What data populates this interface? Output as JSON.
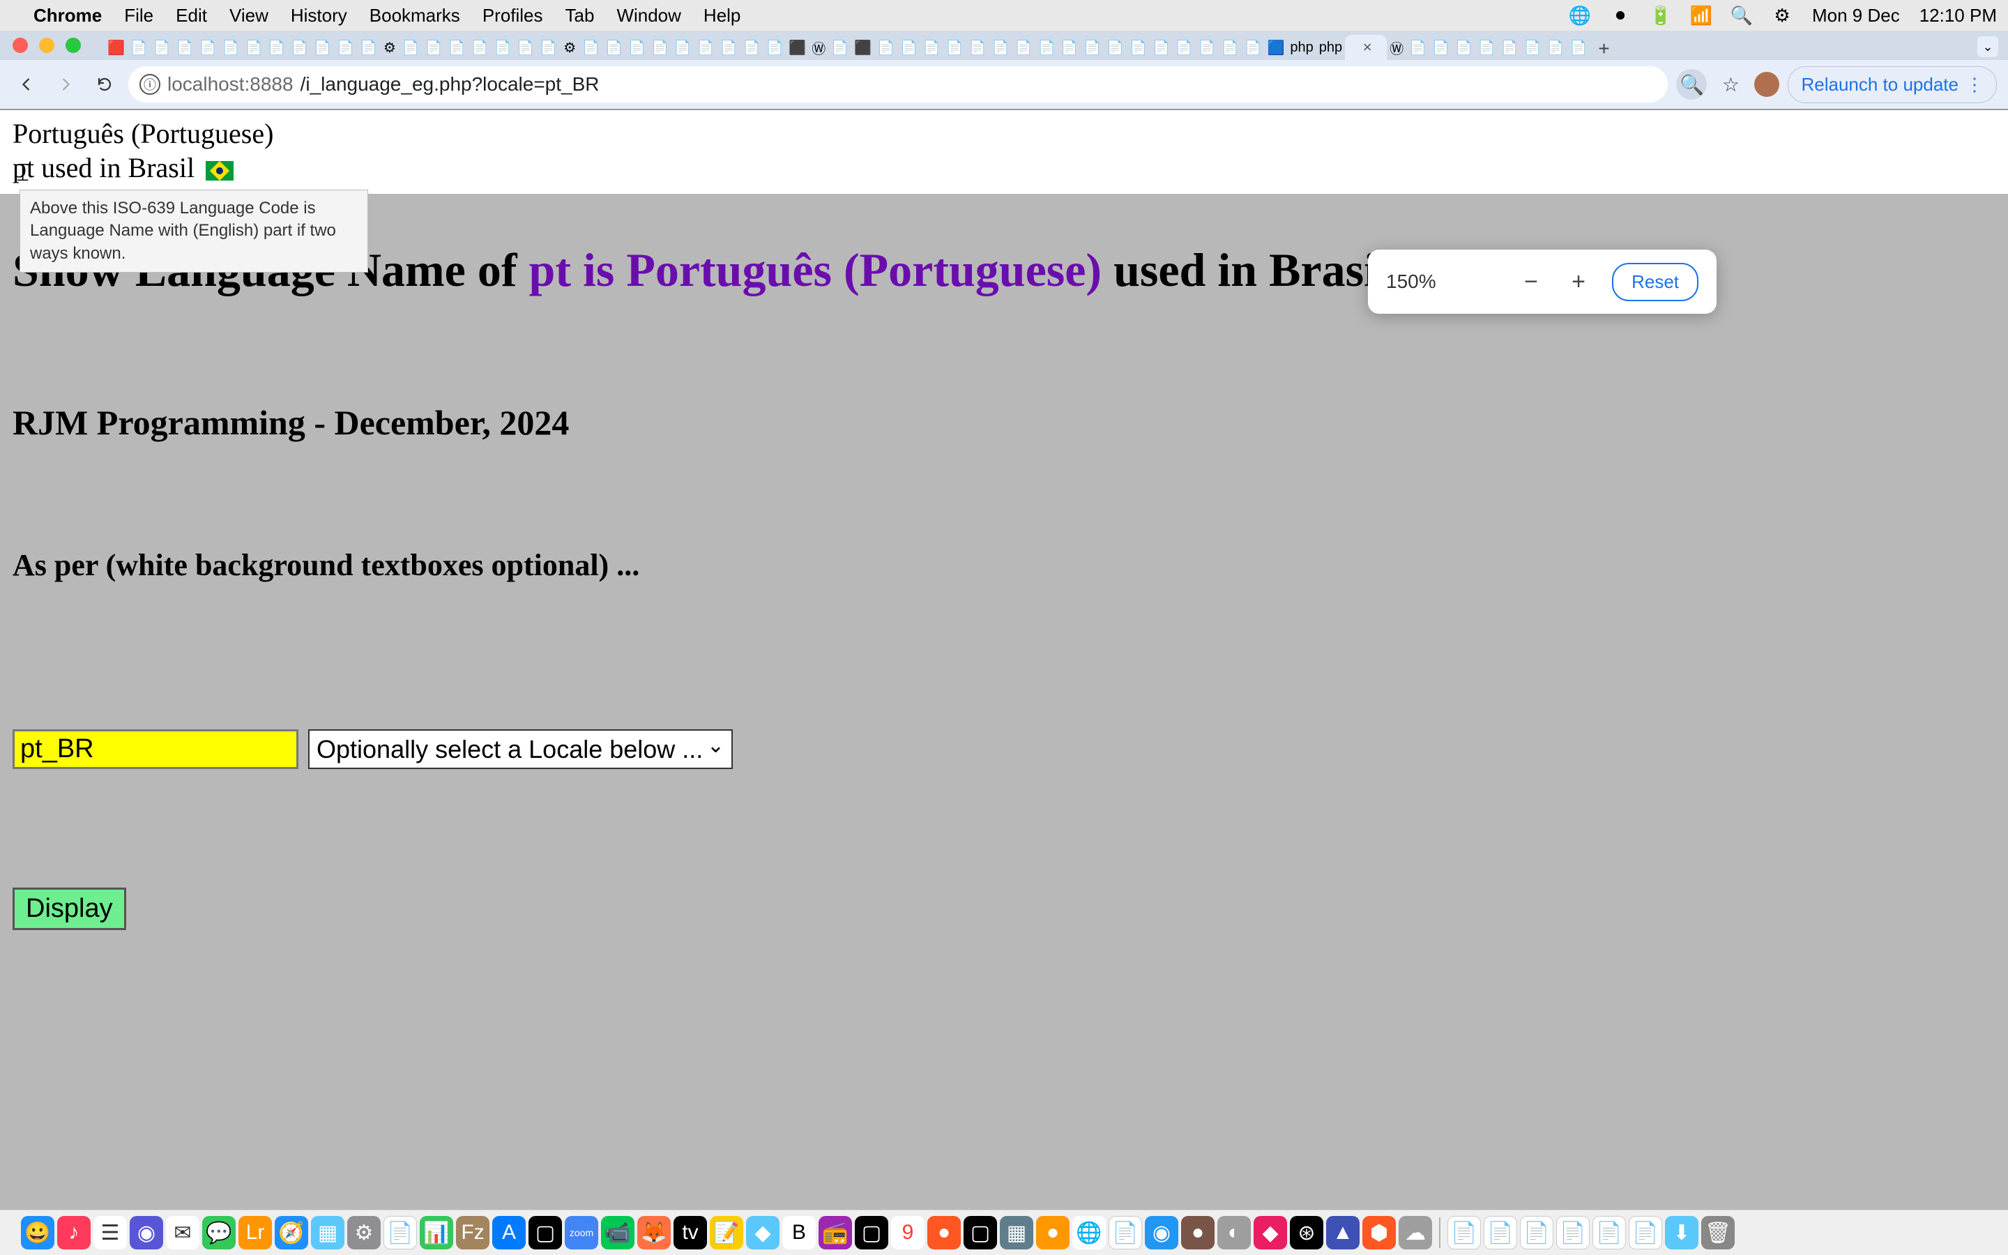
{
  "menubar": {
    "app": "Chrome",
    "items": [
      "File",
      "Edit",
      "View",
      "History",
      "Bookmarks",
      "Profiles",
      "Tab",
      "Window",
      "Help"
    ],
    "date": "Mon 9 Dec",
    "time": "12:10 PM"
  },
  "browser": {
    "active_tab_close": "×",
    "new_tab": "+",
    "tab_dropdown": "⌄",
    "back": "←",
    "forward": "→",
    "reload": "⟳",
    "site_info": "ⓘ",
    "url_host": "localhost:8888",
    "url_path": "/i_language_eg.php?locale=pt_BR",
    "zoom_icon": "🔍⁺",
    "star": "☆",
    "kebab": "⋮",
    "relaunch": "Relaunch to update"
  },
  "zoom": {
    "pct": "150%",
    "minus": "−",
    "plus": "+",
    "reset": "Reset"
  },
  "page": {
    "line1": "Português (Portuguese)",
    "line2_prefix": "pt  used in Brasil ",
    "tooltip": "Above this ISO-639 Language Code is Language Name with (English) part if two ways known.",
    "heading_prefix": "Show Language Name of ",
    "heading_purple": "pt is Português (Portuguese) ",
    "heading_suffix": "used in Brasil ",
    "subheading": "RJM Programming - December, 2024",
    "as_per": "As per (white background textboxes optional) ...",
    "locale_value": "pt_BR",
    "select_placeholder": "Optionally select a Locale below ...",
    "display_btn": "Display"
  },
  "cursor_caret": "I"
}
